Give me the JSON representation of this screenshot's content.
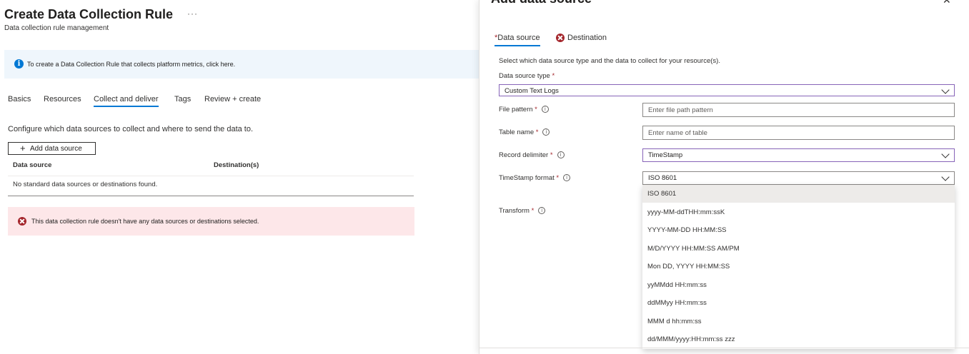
{
  "page": {
    "title": "Create Data Collection Rule",
    "more": "···",
    "subtitle": "Data collection rule management",
    "info": "To create a Data Collection Rule that collects platform metrics, click here.",
    "tabs": [
      "Basics",
      "Resources",
      "Collect and deliver",
      "Tags",
      "Review + create"
    ],
    "active_tab": "Collect and deliver",
    "configure_text": "Configure which data sources to collect and where to send the data to.",
    "add_button": "Add data source",
    "table": {
      "headers": [
        "Data source",
        "Destination(s)"
      ],
      "empty": "No standard data sources or destinations found."
    },
    "error": "This data collection rule doesn't have any data sources or destinations selected."
  },
  "panel": {
    "title": "Add data source",
    "close": "✕",
    "tabs": {
      "data_source": "Data source",
      "destination": "Destination"
    },
    "required_mark": "*",
    "description": "Select which data source type and the data to collect for your resource(s).",
    "data_source_type": {
      "label": "Data source type",
      "value": "Custom Text Logs"
    },
    "file_pattern": {
      "label": "File pattern",
      "placeholder": "Enter file path pattern"
    },
    "table_name": {
      "label": "Table name",
      "placeholder": "Enter name of table"
    },
    "record_delimiter": {
      "label": "Record delimiter",
      "value": "TimeStamp"
    },
    "timestamp_format": {
      "label": "TimeStamp format",
      "value": "ISO 8601",
      "options": [
        "ISO 8601",
        "yyyy-MM-ddTHH:mm:ssK",
        "YYYY-MM-DD HH:MM:SS",
        "M/D/YYYY HH:MM:SS AM/PM",
        "Mon DD, YYYY HH:MM:SS",
        "yyMMdd HH:mm:ss",
        "ddMMyy HH:mm:ss",
        "MMM d hh:mm:ss",
        "dd/MMM/yyyy:HH:mm:ss zzz"
      ]
    },
    "transform": {
      "label": "Transform"
    }
  },
  "colors": {
    "accent": "#0078d4",
    "error": "#a4262c",
    "focus_border": "#8764b8"
  }
}
